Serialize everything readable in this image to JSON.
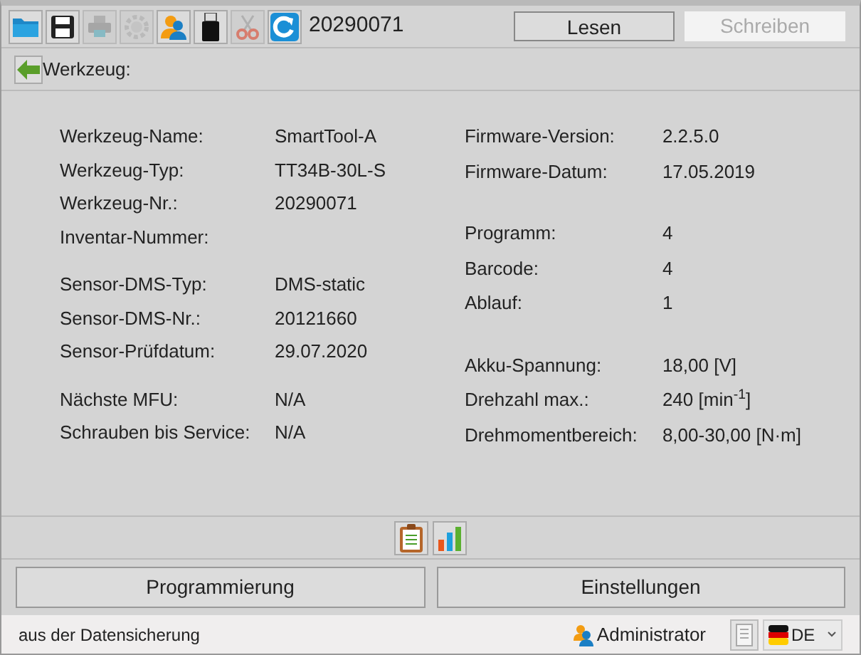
{
  "toolbar": {
    "items": [
      {
        "kind": "folder",
        "disabled": false
      },
      {
        "kind": "save",
        "disabled": false
      },
      {
        "kind": "print",
        "disabled": true
      },
      {
        "kind": "gear",
        "disabled": true
      },
      {
        "kind": "user",
        "disabled": false
      },
      {
        "kind": "usb",
        "disabled": false
      },
      {
        "kind": "scissors",
        "disabled": true
      },
      {
        "kind": "refresh",
        "disabled": false
      }
    ],
    "serial": "20290071",
    "buttons": [
      {
        "label": "Lesen",
        "disabled": false
      },
      {
        "label": "Schreiben",
        "disabled": true
      }
    ]
  },
  "header": {
    "title": "Werkzeug:"
  },
  "details": {
    "left": [
      [
        {
          "label": "Werkzeug-Name:",
          "value": "SmartTool-A"
        },
        {
          "label": "Werkzeug-Typ:",
          "value": "TT34B-30L-S"
        },
        {
          "label": "Werkzeug-Nr.:",
          "value": "20290071"
        },
        {
          "label": "Inventar-Nummer:"
        }
      ],
      [
        {
          "label": "Sensor-DMS-Typ:",
          "value": "DMS-static"
        },
        {
          "label": "Sensor-DMS-Nr.:",
          "value": "20121660"
        },
        {
          "label": "Sensor-Prüfdatum:",
          "value": "29.07.2020"
        }
      ],
      [
        {
          "label": "Nächste MFU:",
          "value": "N/A"
        },
        {
          "label": "Schrauben bis Service:",
          "value": "N/A"
        }
      ]
    ],
    "right": [
      [
        {
          "label": "Firmware-Version:",
          "value": "2.2.5.0"
        },
        {
          "label": "Firmware-Datum:",
          "value": "17.05.2019"
        }
      ],
      [
        {
          "label": "Programm:",
          "value": "4"
        },
        {
          "label": "Barcode:",
          "value": "4"
        },
        {
          "label": "Ablauf:",
          "value": "1"
        }
      ],
      [
        {
          "label": "Akku-Spannung:",
          "value": "18,00 [V]"
        },
        {
          "label": "Drehzahl max.:",
          "value": "240 [min$^{-1}$]"
        },
        {
          "label": "Drehmomentbereich:",
          "value": "8,00-30,00 [N·m]"
        }
      ]
    ]
  },
  "view_buttons": [
    {
      "kind": "checklist"
    },
    {
      "kind": "chart"
    }
  ],
  "actions": [
    "Programmierung",
    "Einstellungen"
  ],
  "status_bar": {
    "message": "aus der Datensicherung",
    "user": "Administrator",
    "language": "DE"
  }
}
